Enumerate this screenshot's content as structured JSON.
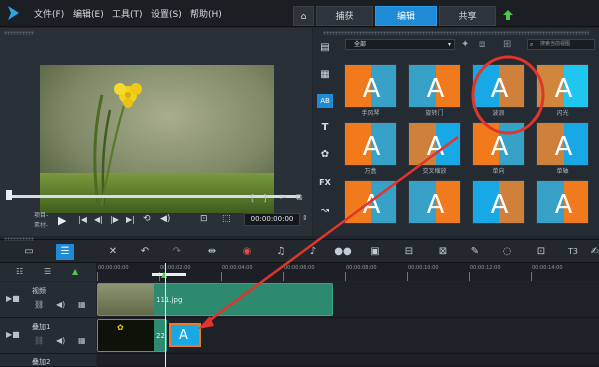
{
  "menubar": {
    "items": [
      "文件(F)",
      "编辑(E)",
      "工具(T)",
      "设置(S)",
      "帮助(H)"
    ],
    "tabs": [
      "捕获",
      "编辑",
      "共享"
    ],
    "active_tab": "编辑"
  },
  "preview": {
    "timecode": "00:00:00:00",
    "project_label": "项目-",
    "clip_label": "素材-"
  },
  "library": {
    "category": "全部",
    "search_placeholder": "搜索当前视图",
    "transitions": [
      {
        "label": "手风琴",
        "color": "#f07a1c"
      },
      {
        "label": "旋转门",
        "color": "#f07a1c"
      },
      {
        "label": "波浪",
        "color": "#18a8e6"
      },
      {
        "label": "闪光",
        "color": "#1ec6f0"
      },
      {
        "label": "万盒",
        "color": "#f07a1c"
      },
      {
        "label": "交叉缩放",
        "color": "#18a8e6"
      },
      {
        "label": "单向",
        "color": "#f07a1c"
      },
      {
        "label": "单轴",
        "color": "#18a8e6"
      },
      {
        "label": "",
        "color": "#f07a1c"
      },
      {
        "label": "",
        "color": "#f07a1c"
      },
      {
        "label": "",
        "color": "#18a8e6"
      },
      {
        "label": "",
        "color": "#f07a1c"
      }
    ]
  },
  "timeline": {
    "ruler": [
      "00:00:00:00",
      "00:00:02:00",
      "00:00:04:00",
      "00:00:06:00",
      "00:00:08:00",
      "00:00:10:00",
      "00:00:12:00",
      "00:00:14:00"
    ],
    "tracks": [
      {
        "name": "视频",
        "clip": "111.jpg"
      },
      {
        "name": "叠加1",
        "clip": "22"
      },
      {
        "name": "叠加2",
        "clip": ""
      }
    ]
  },
  "colors": {
    "accent": "#1f8ad6",
    "clip": "#2d8a6e",
    "annotation": "#e0352b"
  }
}
